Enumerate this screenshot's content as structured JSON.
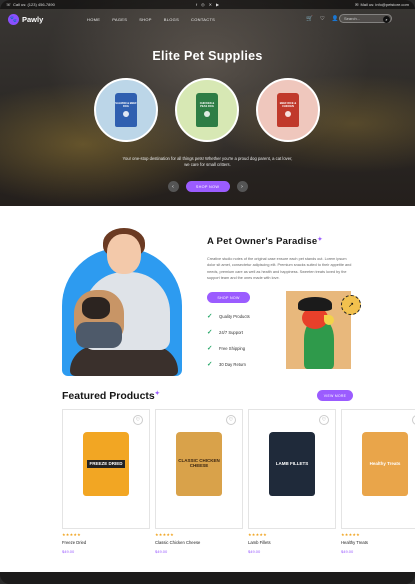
{
  "topbar": {
    "phone": "Call us: (123) 456-7890",
    "social": [
      "f",
      "◎",
      "✕",
      "▶"
    ],
    "email": "Mail us: info@petstore.com"
  },
  "nav": {
    "logo": "Pawly",
    "menu": [
      "HOME",
      "PAGES",
      "SHOP",
      "BLOGS",
      "CONTACTS"
    ],
    "search_placeholder": "Search..."
  },
  "hero": {
    "title": "Elite Pet Supplies",
    "products": [
      {
        "label": "SALMON & BEEF DOG",
        "bag_color": "#2f5fb0",
        "circle_color": "#bcd6e8"
      },
      {
        "label": "CHICKEN & PEAS DOG",
        "bag_color": "#2e7d45",
        "circle_color": "#d7e8b4"
      },
      {
        "label": "BEEF RICE & CHICKEN",
        "bag_color": "#c0392b",
        "circle_color": "#efc7bd"
      }
    ],
    "subtitle": "Your one-stop destination for all things pets! Whether you're a proud dog parent, a cat lover, we care for small critters.",
    "shop_label": "SHOP NOW"
  },
  "about": {
    "title": "A Pet Owner's Paradise",
    "text": "Creative studio notes of the original case ensure each pet stands out. Lorem ipsum dolor sit amet, consectetur adipiscing elit. Premium snacks suited to their appetite and needs, premium care as well as health and happiness. Sweeten treats loved by the support team and the ones made with love.",
    "button_label": "SHOP NOW",
    "features": [
      "Quality Products",
      "24/7 Support",
      "Free Shipping",
      "30 Day Return"
    ]
  },
  "featured": {
    "title": "Featured Products",
    "view_label": "VIEW MORE",
    "products": [
      {
        "name": "Freeze Dried",
        "price": "$49.00",
        "stars": "★★★★★",
        "bag_label": "FREEZE DRIED",
        "color": "#f2a623"
      },
      {
        "name": "Classic Chicken Cheese",
        "price": "$49.00",
        "stars": "★★★★★",
        "bag_label": "CLASSIC CHICKEN CHEESE",
        "color": "#d9a24a"
      },
      {
        "name": "Lamb Fillets",
        "price": "$49.00",
        "stars": "★★★★★",
        "bag_label": "LAMB FILLETS",
        "color": "#1f2a3a"
      },
      {
        "name": "Healthy Treats",
        "price": "$49.00",
        "stars": "★★★★★",
        "bag_label": "Healthy Treats",
        "color": "#e9a54a"
      }
    ]
  }
}
